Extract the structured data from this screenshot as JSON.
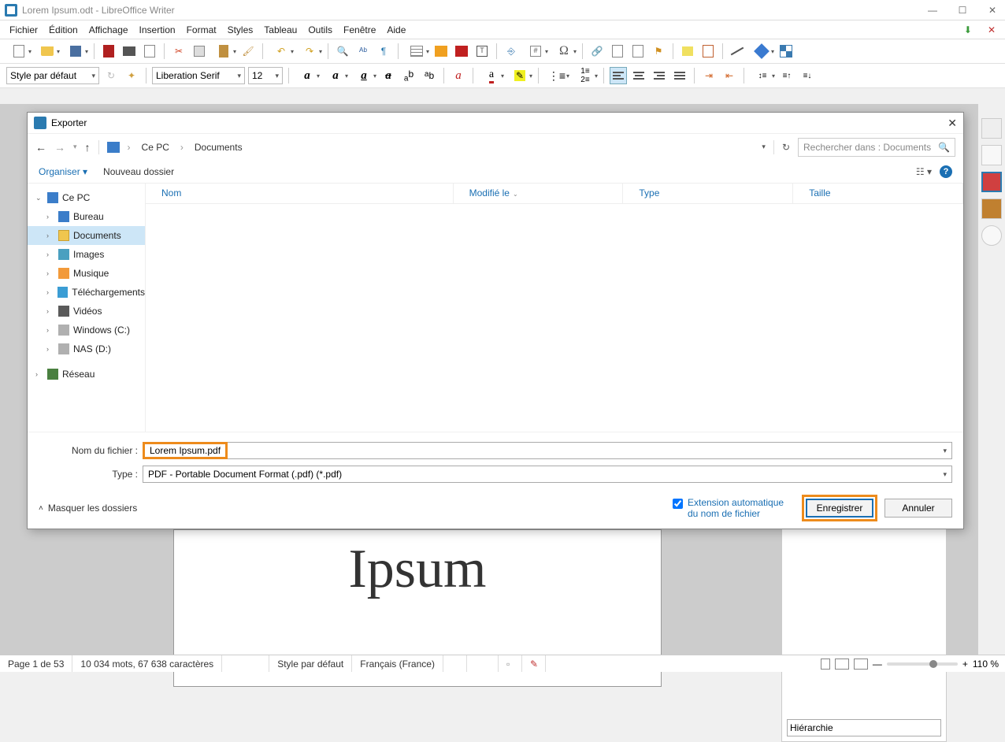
{
  "window": {
    "title": "Lorem Ipsum.odt - LibreOffice Writer"
  },
  "menu": {
    "file": "Fichier",
    "edit": "Édition",
    "view": "Affichage",
    "insert": "Insertion",
    "format": "Format",
    "styles": "Styles",
    "table": "Tableau",
    "tools": "Outils",
    "window": "Fenêtre",
    "help": "Aide"
  },
  "format_bar": {
    "para_style": "Style par défaut",
    "font_name": "Liberation Serif",
    "font_size": "12"
  },
  "document": {
    "visible_word": "Ipsum"
  },
  "side_panel": {
    "combo": "Hiérarchie"
  },
  "statusbar": {
    "page": "Page 1 de 53",
    "words": "10 034 mots, 67 638 caractères",
    "style": "Style par défaut",
    "lang": "Français (France)",
    "zoom": "110 %"
  },
  "dialog": {
    "title": "Exporter",
    "breadcrumb": {
      "root": "Ce PC",
      "current": "Documents"
    },
    "search_placeholder": "Rechercher dans : Documents",
    "organize": "Organiser",
    "new_folder": "Nouveau dossier",
    "columns": {
      "name": "Nom",
      "modified": "Modifié le",
      "type": "Type",
      "size": "Taille"
    },
    "tree": {
      "pc": "Ce PC",
      "desktop": "Bureau",
      "documents": "Documents",
      "images": "Images",
      "music": "Musique",
      "downloads": "Téléchargements",
      "videos": "Vidéos",
      "cdrive": "Windows (C:)",
      "ddrive": "NAS (D:)",
      "network": "Réseau"
    },
    "filename_label": "Nom du fichier :",
    "filename_value": "Lorem Ipsum.pdf",
    "type_label": "Type :",
    "type_value": "PDF - Portable Document Format (.pdf) (*.pdf)",
    "hide_folders": "Masquer les dossiers",
    "auto_ext": "Extension automatique du nom de fichier",
    "save": "Enregistrer",
    "cancel": "Annuler"
  }
}
